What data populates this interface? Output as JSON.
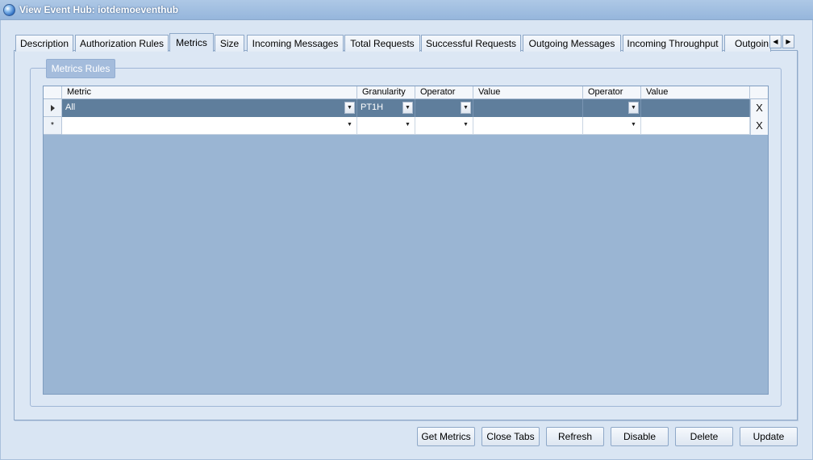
{
  "window": {
    "title": "View Event Hub: iotdemoeventhub"
  },
  "tabs": [
    {
      "label": "Description"
    },
    {
      "label": "Authorization Rules"
    },
    {
      "label": "Metrics"
    },
    {
      "label": "Size"
    },
    {
      "label": "Incoming Messages"
    },
    {
      "label": "Total Requests"
    },
    {
      "label": "Successful Requests"
    },
    {
      "label": "Outgoing Messages"
    },
    {
      "label": "Incoming Throughput"
    },
    {
      "label": "Outgoin"
    }
  ],
  "active_tab": "Metrics",
  "group": {
    "label": "Metrics Rules"
  },
  "grid": {
    "columns": [
      "Metric",
      "Granularity",
      "Operator",
      "Value",
      "Operator",
      "Value"
    ],
    "rows": [
      {
        "metric": "All",
        "granularity": "PT1H",
        "operator1": "",
        "value1": "",
        "operator2": "",
        "value2": "",
        "delete": "X"
      },
      {
        "marker": "*",
        "metric": "",
        "granularity": "",
        "operator1": "",
        "value1": "",
        "operator2": "",
        "value2": "",
        "delete": "X"
      }
    ]
  },
  "buttons": {
    "get_metrics": "Get Metrics",
    "close_tabs": "Close Tabs",
    "refresh": "Refresh",
    "disable": "Disable",
    "delete": "Delete",
    "update": "Update"
  },
  "icons": {
    "title_icon": "globe-icon",
    "tab_scroll_left": "arrow-left-icon",
    "tab_scroll_right": "arrow-right-icon"
  }
}
